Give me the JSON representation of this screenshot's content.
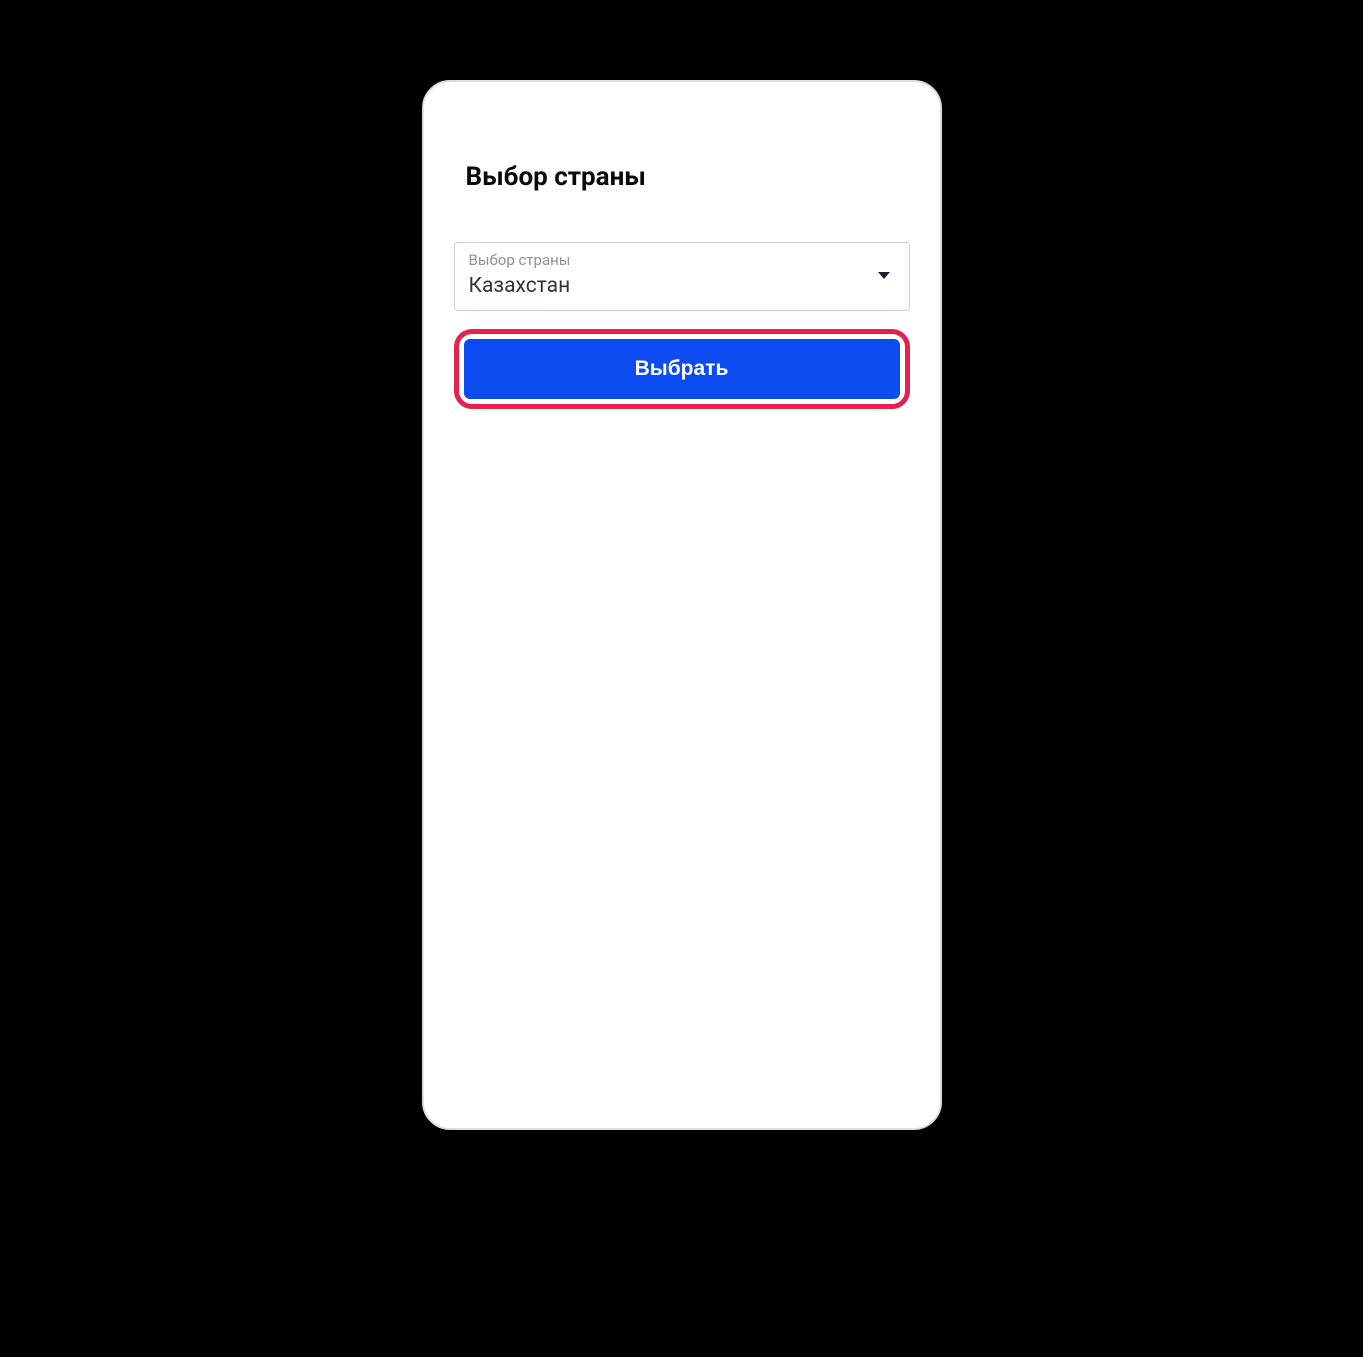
{
  "page": {
    "title": "Выбор страны"
  },
  "countrySelect": {
    "label": "Выбор страны",
    "value": "Казахстан"
  },
  "actions": {
    "submitLabel": "Выбрать"
  },
  "colors": {
    "primary": "#0b4bef",
    "highlight": "#e4214f"
  }
}
